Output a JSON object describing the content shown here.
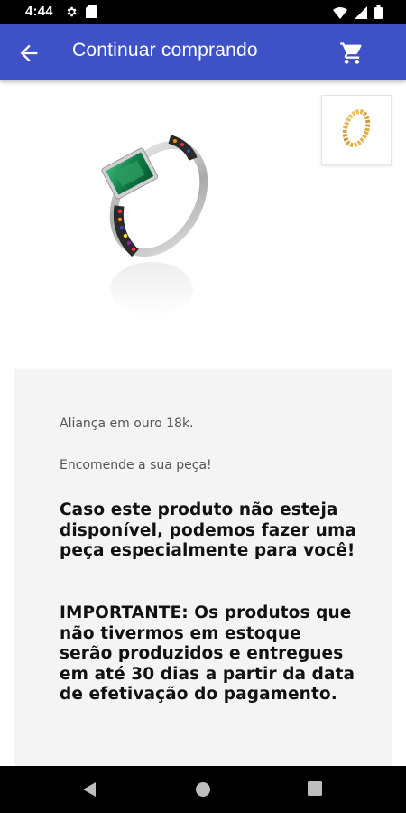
{
  "status_bar": {
    "time": "4:44",
    "icons": [
      "settings-icon",
      "sd-card-icon",
      "wifi-icon",
      "signal-icon",
      "battery-icon"
    ]
  },
  "app_bar": {
    "title": "Continuar comprando",
    "color": "#3f51c6",
    "back_icon": "arrow-back-icon",
    "cart_icon": "shopping-cart-icon"
  },
  "product": {
    "main_image": "silver-ring-emerald-image",
    "thumbnail": "gold-ring-thumbnail"
  },
  "description": {
    "line1": "Aliança em ouro 18k.",
    "line2": "Encomende a sua peça!",
    "para1": "Caso este produto não esteja disponível, podemos fazer uma peça especialmente para você!",
    "para2": "IMPORTANTE: Os produtos que não tivermos em estoque serão produzidos e entregues em até 30 dias a partir da data de efetivação do pagamento."
  },
  "nav_bar": {
    "icons": [
      "nav-back-icon",
      "nav-home-icon",
      "nav-recents-icon"
    ]
  }
}
